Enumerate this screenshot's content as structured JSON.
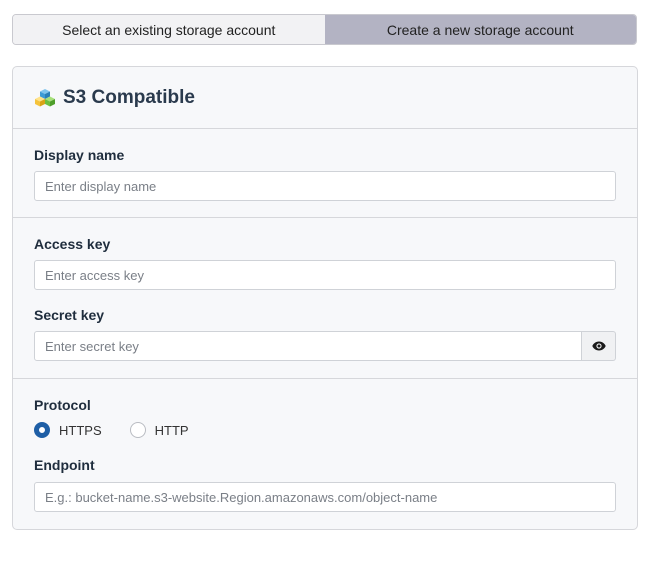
{
  "tabs": [
    {
      "label": "Select an existing storage account",
      "active": false
    },
    {
      "label": "Create a new storage account",
      "active": true
    }
  ],
  "card": {
    "title": "S3 Compatible",
    "icon": "cube-icon"
  },
  "fields": {
    "display_name": {
      "label": "Display name",
      "placeholder": "Enter display name",
      "value": ""
    },
    "access_key": {
      "label": "Access key",
      "placeholder": "Enter access key",
      "value": ""
    },
    "secret_key": {
      "label": "Secret key",
      "placeholder": "Enter secret key",
      "value": "",
      "toggle_icon": "eye-icon"
    },
    "protocol": {
      "label": "Protocol",
      "options": [
        "HTTPS",
        "HTTP"
      ],
      "selected": "HTTPS"
    },
    "endpoint": {
      "label": "Endpoint",
      "placeholder": "E.g.: bucket-name.s3-website.Region.amazonaws.com/object-name",
      "value": ""
    }
  },
  "colors": {
    "tab_active": "#b3b3c3",
    "tab_inactive": "#f2f2f4",
    "radio_checked": "#1f5fa6",
    "card_bg": "#f7f8fa"
  }
}
